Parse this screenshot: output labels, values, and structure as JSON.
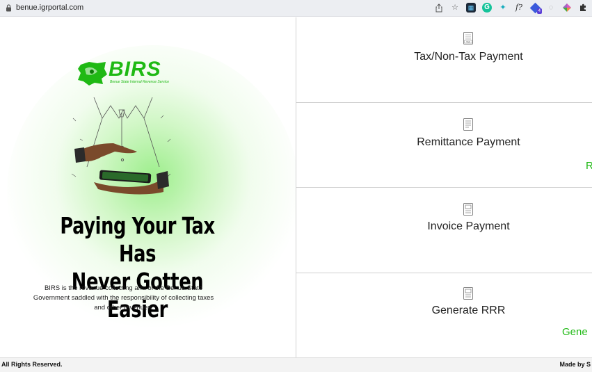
{
  "browser": {
    "url": "benue.igrportal.com",
    "extensions": [
      "share-icon",
      "star-icon",
      "ext-icon-1",
      "grammarly-icon",
      "ext-icon-2",
      "formula-icon",
      "ext-icon-3",
      "clock-icon",
      "ext-icon-4",
      "puzzle-icon"
    ],
    "formula_text": "f?",
    "badge_count": "4"
  },
  "brand": {
    "logo_text": "BIRS",
    "logo_subtitle": "Benue State Internal Revenue Service",
    "accent": "#1fb914"
  },
  "hero": {
    "headline_line1": "Paying Your Tax Has",
    "headline_line2": "Never Gotten Easier",
    "description": "BIRS is the revenue collecting arm of the Benue State Government saddled with the responsibility of collecting taxes and other revenues."
  },
  "options": [
    {
      "label": "Tax/Non-Tax Payment",
      "icon": "tax-document-icon",
      "icon_text": "TAX"
    },
    {
      "label": "Remittance Payment",
      "icon": "receipt-icon",
      "overflow_text": "R"
    },
    {
      "label": "Invoice Payment",
      "icon": "invoice-icon"
    },
    {
      "label": "Generate RRR",
      "icon": "generate-document-icon",
      "overflow_text": "Gene"
    }
  ],
  "footer": {
    "left": "All Rights Reserved.",
    "right": "Made by S"
  }
}
